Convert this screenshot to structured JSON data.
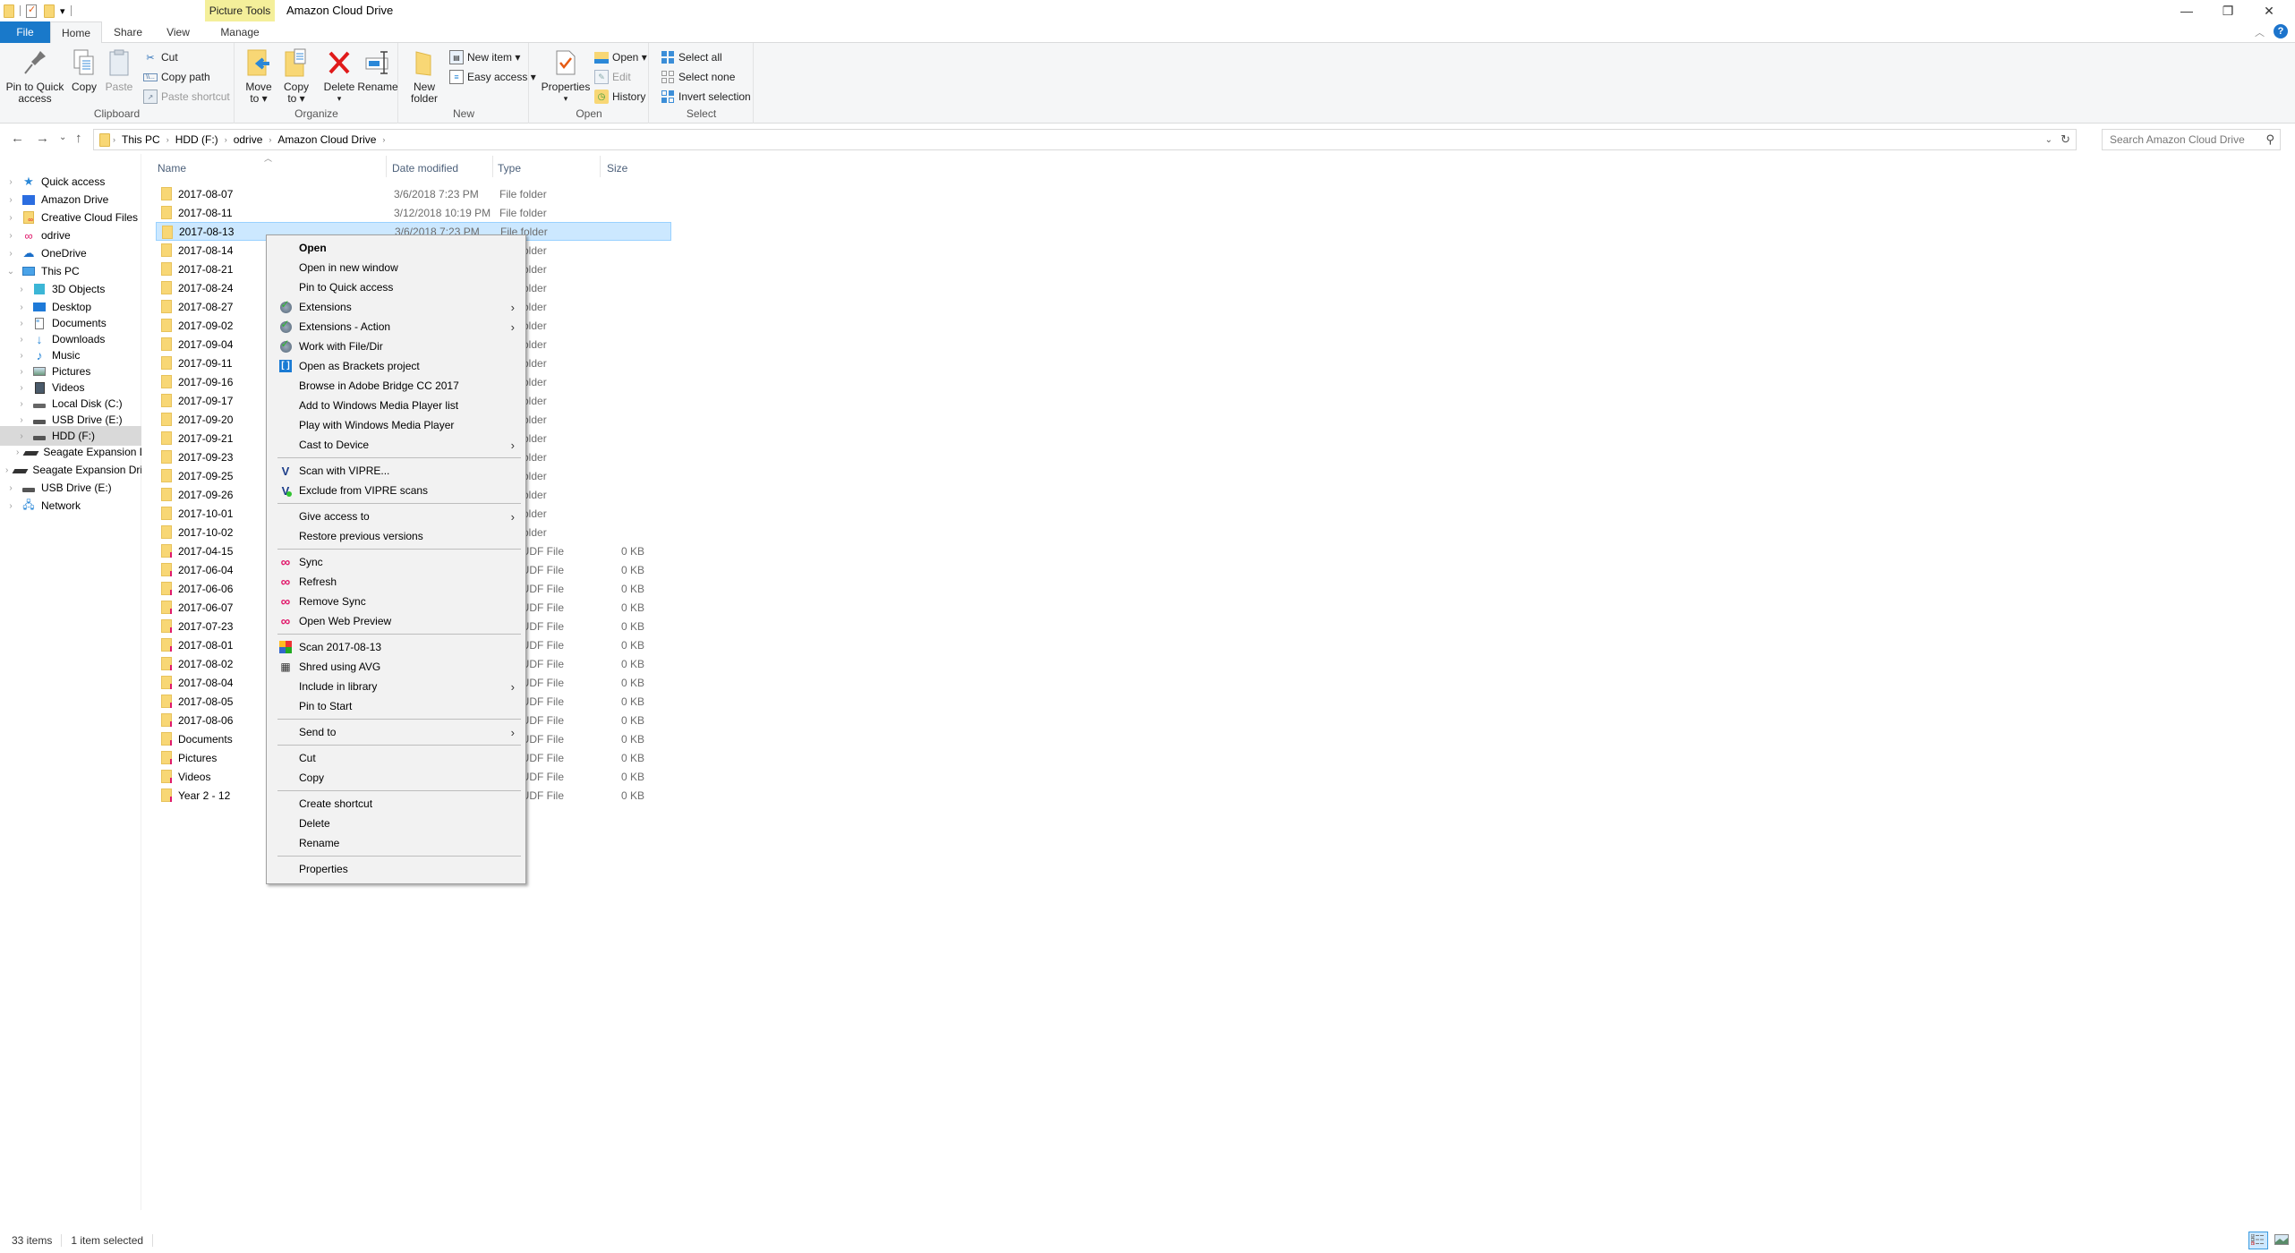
{
  "window": {
    "title": "Amazon Cloud Drive",
    "contextual_tab_group": "Picture Tools",
    "controls": {
      "minimize": "—",
      "restore": "❐",
      "close": "✕"
    }
  },
  "quick_access_toolbar": [
    "folder-icon",
    "properties-icon",
    "new-folder-icon",
    "customize-dropdown-icon"
  ],
  "tabs": [
    {
      "label": "File",
      "active": false
    },
    {
      "label": "Home",
      "active": true
    },
    {
      "label": "Share",
      "active": false
    },
    {
      "label": "View",
      "active": false
    },
    {
      "label": "Manage",
      "active": false
    }
  ],
  "ribbon": {
    "clipboard": {
      "label": "Clipboard",
      "pin": "Pin to Quick access",
      "pin_line1": "Pin to Quick",
      "pin_line2": "access",
      "copy": "Copy",
      "paste": "Paste",
      "cut": "Cut",
      "copy_path": "Copy path",
      "paste_shortcut": "Paste shortcut"
    },
    "organize": {
      "label": "Organize",
      "move_to_1": "Move",
      "move_to_2": "to ▾",
      "copy_to_1": "Copy",
      "copy_to_2": "to ▾",
      "delete": "Delete",
      "delete_arrow": "▾",
      "rename": "Rename"
    },
    "new": {
      "label": "New",
      "new_folder_1": "New",
      "new_folder_2": "folder",
      "new_item": "New item ▾",
      "easy_access": "Easy access ▾"
    },
    "open": {
      "label": "Open",
      "properties": "Properties",
      "properties_arrow": "▾",
      "open": "Open ▾",
      "edit": "Edit",
      "history": "History"
    },
    "select": {
      "label": "Select",
      "select_all": "Select all",
      "select_none": "Select none",
      "invert_selection": "Invert selection"
    }
  },
  "navigation": {
    "back": "←",
    "forward": "→",
    "recent": "⌄",
    "up": "↑",
    "breadcrumbs": [
      "This PC",
      "HDD (F:)",
      "odrive",
      "Amazon Cloud Drive"
    ],
    "search_placeholder": "Search Amazon Cloud Drive"
  },
  "nav_pane": [
    {
      "label": "Quick access",
      "icon": "star-icon",
      "level": 0,
      "expanded": false
    },
    {
      "label": "Amazon Drive",
      "icon": "amazon-drive-icon",
      "level": 0,
      "expanded": false
    },
    {
      "label": "Creative Cloud Files",
      "icon": "creative-cloud-icon",
      "level": 0,
      "expanded": false
    },
    {
      "label": "odrive",
      "icon": "odrive-icon",
      "level": 0,
      "expanded": false
    },
    {
      "label": "OneDrive",
      "icon": "onedrive-icon",
      "level": 0,
      "expanded": false
    },
    {
      "label": "This PC",
      "icon": "computer-icon",
      "level": 0,
      "expanded": true
    },
    {
      "label": "3D Objects",
      "icon": "3d-objects-icon",
      "level": 1,
      "expanded": false
    },
    {
      "label": "Desktop",
      "icon": "desktop-icon",
      "level": 1,
      "expanded": false
    },
    {
      "label": "Documents",
      "icon": "documents-icon",
      "level": 1,
      "expanded": false
    },
    {
      "label": "Downloads",
      "icon": "downloads-icon",
      "level": 1,
      "expanded": false
    },
    {
      "label": "Music",
      "icon": "music-icon",
      "level": 1,
      "expanded": false
    },
    {
      "label": "Pictures",
      "icon": "pictures-icon",
      "level": 1,
      "expanded": false
    },
    {
      "label": "Videos",
      "icon": "videos-icon",
      "level": 1,
      "expanded": false
    },
    {
      "label": "Local Disk (C:)",
      "icon": "local-disk-icon",
      "level": 1,
      "expanded": false
    },
    {
      "label": "USB Drive (E:)",
      "icon": "drive-icon",
      "level": 1,
      "expanded": false
    },
    {
      "label": "HDD (F:)",
      "icon": "drive-icon",
      "level": 1,
      "expanded": false,
      "selected": true
    },
    {
      "label": "Seagate Expansion Drive",
      "icon": "external-drive-icon",
      "level": 1,
      "expanded": false
    },
    {
      "label": "Seagate Expansion Drive",
      "icon": "external-drive-icon",
      "level": 0,
      "expanded": false
    },
    {
      "label": "USB Drive (E:)",
      "icon": "drive-icon",
      "level": 0,
      "expanded": false
    },
    {
      "label": "Network",
      "icon": "network-icon",
      "level": 0,
      "expanded": false
    }
  ],
  "columns": {
    "name": "Name",
    "date": "Date modified",
    "type": "Type",
    "size": "Size"
  },
  "files": [
    {
      "name": "2017-08-07",
      "date": "3/6/2018 7:23 PM",
      "type": "File folder",
      "size": "",
      "odrive": false
    },
    {
      "name": "2017-08-11",
      "date": "3/12/2018 10:19 PM",
      "type": "File folder",
      "size": "",
      "odrive": false
    },
    {
      "name": "2017-08-13",
      "date": "3/6/2018 7:23 PM",
      "type": "File folder",
      "size": "",
      "odrive": false,
      "selected": true
    },
    {
      "name": "2017-08-14",
      "date": "",
      "type": "File folder",
      "size": "",
      "odrive": false
    },
    {
      "name": "2017-08-21",
      "date": "",
      "type": "File folder",
      "size": "",
      "odrive": false
    },
    {
      "name": "2017-08-24",
      "date": "",
      "type": "File folder",
      "size": "",
      "odrive": false
    },
    {
      "name": "2017-08-27",
      "date": "",
      "type": "File folder",
      "size": "",
      "odrive": false
    },
    {
      "name": "2017-09-02",
      "date": "",
      "type": "File folder",
      "size": "",
      "odrive": false
    },
    {
      "name": "2017-09-04",
      "date": "",
      "type": "File folder",
      "size": "",
      "odrive": false
    },
    {
      "name": "2017-09-11",
      "date": "",
      "type": "File folder",
      "size": "",
      "odrive": false
    },
    {
      "name": "2017-09-16",
      "date": "",
      "type": "File folder",
      "size": "",
      "odrive": false
    },
    {
      "name": "2017-09-17",
      "date": "",
      "type": "File folder",
      "size": "",
      "odrive": false
    },
    {
      "name": "2017-09-20",
      "date": "",
      "type": "File folder",
      "size": "",
      "odrive": false
    },
    {
      "name": "2017-09-21",
      "date": "",
      "type": "File folder",
      "size": "",
      "odrive": false
    },
    {
      "name": "2017-09-23",
      "date": "",
      "type": "File folder",
      "size": "",
      "odrive": false
    },
    {
      "name": "2017-09-25",
      "date": "",
      "type": "File folder",
      "size": "",
      "odrive": false
    },
    {
      "name": "2017-09-26",
      "date": "",
      "type": "File folder",
      "size": "",
      "odrive": false
    },
    {
      "name": "2017-10-01",
      "date": "",
      "type": "File folder",
      "size": "",
      "odrive": false
    },
    {
      "name": "2017-10-02",
      "date": "",
      "type": "File folder",
      "size": "",
      "odrive": false
    },
    {
      "name": "2017-04-15",
      "date": "",
      "type": "CLOUDF File",
      "size": "0 KB",
      "odrive": true
    },
    {
      "name": "2017-06-04",
      "date": "",
      "type": "CLOUDF File",
      "size": "0 KB",
      "odrive": true
    },
    {
      "name": "2017-06-06",
      "date": "",
      "type": "CLOUDF File",
      "size": "0 KB",
      "odrive": true
    },
    {
      "name": "2017-06-07",
      "date": "",
      "type": "CLOUDF File",
      "size": "0 KB",
      "odrive": true
    },
    {
      "name": "2017-07-23",
      "date": "",
      "type": "CLOUDF File",
      "size": "0 KB",
      "odrive": true
    },
    {
      "name": "2017-08-01",
      "date": "",
      "type": "CLOUDF File",
      "size": "0 KB",
      "odrive": true
    },
    {
      "name": "2017-08-02",
      "date": "",
      "type": "CLOUDF File",
      "size": "0 KB",
      "odrive": true
    },
    {
      "name": "2017-08-04",
      "date": "",
      "type": "CLOUDF File",
      "size": "0 KB",
      "odrive": true
    },
    {
      "name": "2017-08-05",
      "date": "",
      "type": "CLOUDF File",
      "size": "0 KB",
      "odrive": true
    },
    {
      "name": "2017-08-06",
      "date": "",
      "type": "CLOUDF File",
      "size": "0 KB",
      "odrive": true
    },
    {
      "name": "Documents",
      "date": "",
      "type": "CLOUDF File",
      "size": "0 KB",
      "odrive": true
    },
    {
      "name": "Pictures",
      "date": "",
      "type": "CLOUDF File",
      "size": "0 KB",
      "odrive": true
    },
    {
      "name": "Videos",
      "date": "",
      "type": "CLOUDF File",
      "size": "0 KB",
      "odrive": true
    },
    {
      "name": "Year 2 - 12",
      "date": "",
      "type": "CLOUDF File",
      "size": "0 KB",
      "odrive": true
    }
  ],
  "context_menu": [
    {
      "label": "Open",
      "bold": true
    },
    {
      "label": "Open in new window"
    },
    {
      "label": "Pin to Quick access"
    },
    {
      "label": "Extensions",
      "icon": "check-globe-icon",
      "submenu": true
    },
    {
      "label": "Extensions - Action",
      "icon": "check-globe-icon",
      "submenu": true
    },
    {
      "label": "Work with File/Dir",
      "icon": "check-globe-icon"
    },
    {
      "label": "Open as Brackets project",
      "icon": "brackets-icon"
    },
    {
      "label": "Browse in Adobe Bridge CC 2017"
    },
    {
      "label": "Add to Windows Media Player list"
    },
    {
      "label": "Play with Windows Media Player"
    },
    {
      "label": "Cast to Device",
      "submenu": true
    },
    {
      "separator": true
    },
    {
      "label": "Scan with VIPRE...",
      "icon": "vipre-icon"
    },
    {
      "label": "Exclude from VIPRE scans",
      "icon": "vipre-exclude-icon"
    },
    {
      "separator": true
    },
    {
      "label": "Give access to",
      "submenu": true
    },
    {
      "label": "Restore previous versions"
    },
    {
      "separator": true
    },
    {
      "label": "Sync",
      "icon": "odrive-icon"
    },
    {
      "label": "Refresh",
      "icon": "odrive-icon"
    },
    {
      "label": "Remove Sync",
      "icon": "odrive-icon"
    },
    {
      "label": "Open Web Preview",
      "icon": "odrive-icon"
    },
    {
      "separator": true
    },
    {
      "label": "Scan 2017-08-13",
      "icon": "avg-icon"
    },
    {
      "label": "Shred using AVG",
      "icon": "shredder-icon"
    },
    {
      "label": "Include in library",
      "submenu": true
    },
    {
      "label": "Pin to Start"
    },
    {
      "separator": true
    },
    {
      "label": "Send to",
      "submenu": true
    },
    {
      "separator": true
    },
    {
      "label": "Cut"
    },
    {
      "label": "Copy"
    },
    {
      "separator": true
    },
    {
      "label": "Create shortcut"
    },
    {
      "label": "Delete"
    },
    {
      "label": "Rename"
    },
    {
      "separator": true
    },
    {
      "label": "Properties"
    }
  ],
  "status": {
    "items_count": "33 items",
    "selected_count": "1 item selected"
  },
  "colors": {
    "file_tab": "#1979ca",
    "picture_tools": "#f4ef9a",
    "selection_bg": "#cce8ff",
    "selection_border": "#99d1ff",
    "odrive_pink": "#e0196b",
    "folder_yellow": "#f8d775"
  }
}
